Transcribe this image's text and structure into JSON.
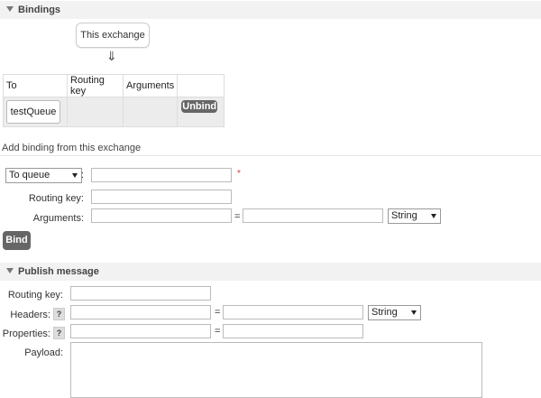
{
  "bindings_section": {
    "title": "Bindings",
    "source_label": "This exchange",
    "arrow_glyph": "⇓",
    "table": {
      "headers": [
        "To",
        "Routing key",
        "Arguments",
        ""
      ],
      "rows": [
        {
          "to": "testQueue",
          "routing_key": "",
          "arguments": "",
          "action": "Unbind"
        }
      ]
    }
  },
  "add_binding": {
    "heading": "Add binding from this exchange",
    "destination_type": "To queue",
    "destination_sep": ":",
    "required_marker": "*",
    "routing_key_label": "Routing key:",
    "arguments_label": "Arguments:",
    "equals": "=",
    "argument_type": "String",
    "bind_button": "Bind"
  },
  "publish_section": {
    "title": "Publish message",
    "routing_key_label": "Routing key:",
    "headers_label": "Headers:",
    "properties_label": "Properties:",
    "payload_label": "Payload:",
    "help_glyph": "?",
    "equals": "=",
    "header_type": "String"
  }
}
